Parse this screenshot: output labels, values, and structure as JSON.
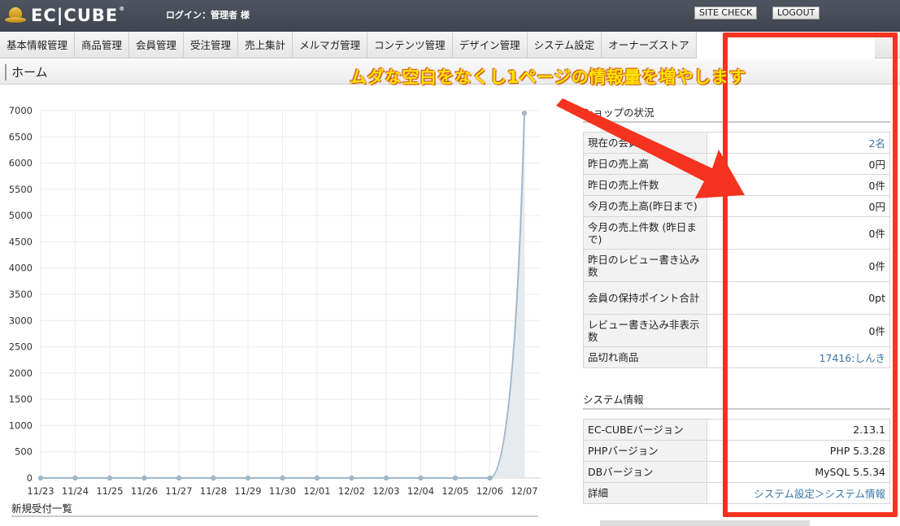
{
  "header": {
    "logo_text": "EC|CUBE",
    "logo_mark": "®",
    "login_text": "ログイン：管理者 様",
    "site_check_label": "SITE CHECK",
    "logout_label": "LOGOUT"
  },
  "nav": {
    "items": [
      "基本情報管理",
      "商品管理",
      "会員管理",
      "受注管理",
      "売上集計",
      "メルマガ管理",
      "コンテンツ管理",
      "デザイン管理",
      "システム設定",
      "オーナーズストア"
    ]
  },
  "page_title": "ホーム",
  "annotation": {
    "callout": "ムダな空白をなくし1ページの情報量を増やします",
    "color": "#f5331e"
  },
  "chart_data": {
    "type": "area",
    "categories": [
      "11/23",
      "11/24",
      "11/25",
      "11/26",
      "11/27",
      "11/28",
      "11/29",
      "11/30",
      "12/01",
      "12/02",
      "12/03",
      "12/04",
      "12/05",
      "12/06",
      "12/07"
    ],
    "values": [
      0,
      0,
      0,
      0,
      0,
      0,
      0,
      0,
      0,
      0,
      0,
      0,
      0,
      0,
      6950
    ],
    "yticks": [
      0,
      500,
      1000,
      1500,
      2000,
      2500,
      3000,
      3500,
      4000,
      4500,
      5000,
      5500,
      6000,
      6500,
      7000
    ],
    "ylim": [
      0,
      7000
    ],
    "grid": true,
    "line_color": "#9fb7c9",
    "fill_color": "#e6ebef"
  },
  "new_orders_title": "新規受付一覧",
  "shop_status": {
    "title": "ショップの状況",
    "rows": [
      {
        "label": "現在の会員数",
        "value": "2名",
        "link": true
      },
      {
        "label": "昨日の売上高",
        "value": "0円",
        "link": false
      },
      {
        "label": "昨日の売上件数",
        "value": "0件",
        "link": false
      },
      {
        "label": "今月の売上高(昨日まで)",
        "value": "0円",
        "link": false
      },
      {
        "label": "今月の売上件数 (昨日まで)",
        "value": "0件",
        "link": false
      },
      {
        "label": "昨日のレビュー書き込み数",
        "value": "0件",
        "link": false
      },
      {
        "label": "会員の保持ポイント合計",
        "value": "0pt",
        "link": false
      },
      {
        "label": "レビュー書き込み非表示数",
        "value": "0件",
        "link": false
      },
      {
        "label": "品切れ商品",
        "value": "17416:しんき",
        "link": true
      }
    ]
  },
  "system_info": {
    "title": "システム情報",
    "rows": [
      {
        "label": "EC-CUBEバージョン",
        "value": "2.13.1",
        "link": false
      },
      {
        "label": "PHPバージョン",
        "value": "PHP 5.3.28",
        "link": false
      },
      {
        "label": "DBバージョン",
        "value": "MySQL 5.5.34",
        "link": false
      },
      {
        "label": "詳細",
        "value": "システム設定＞システム情報",
        "link": true
      }
    ]
  }
}
